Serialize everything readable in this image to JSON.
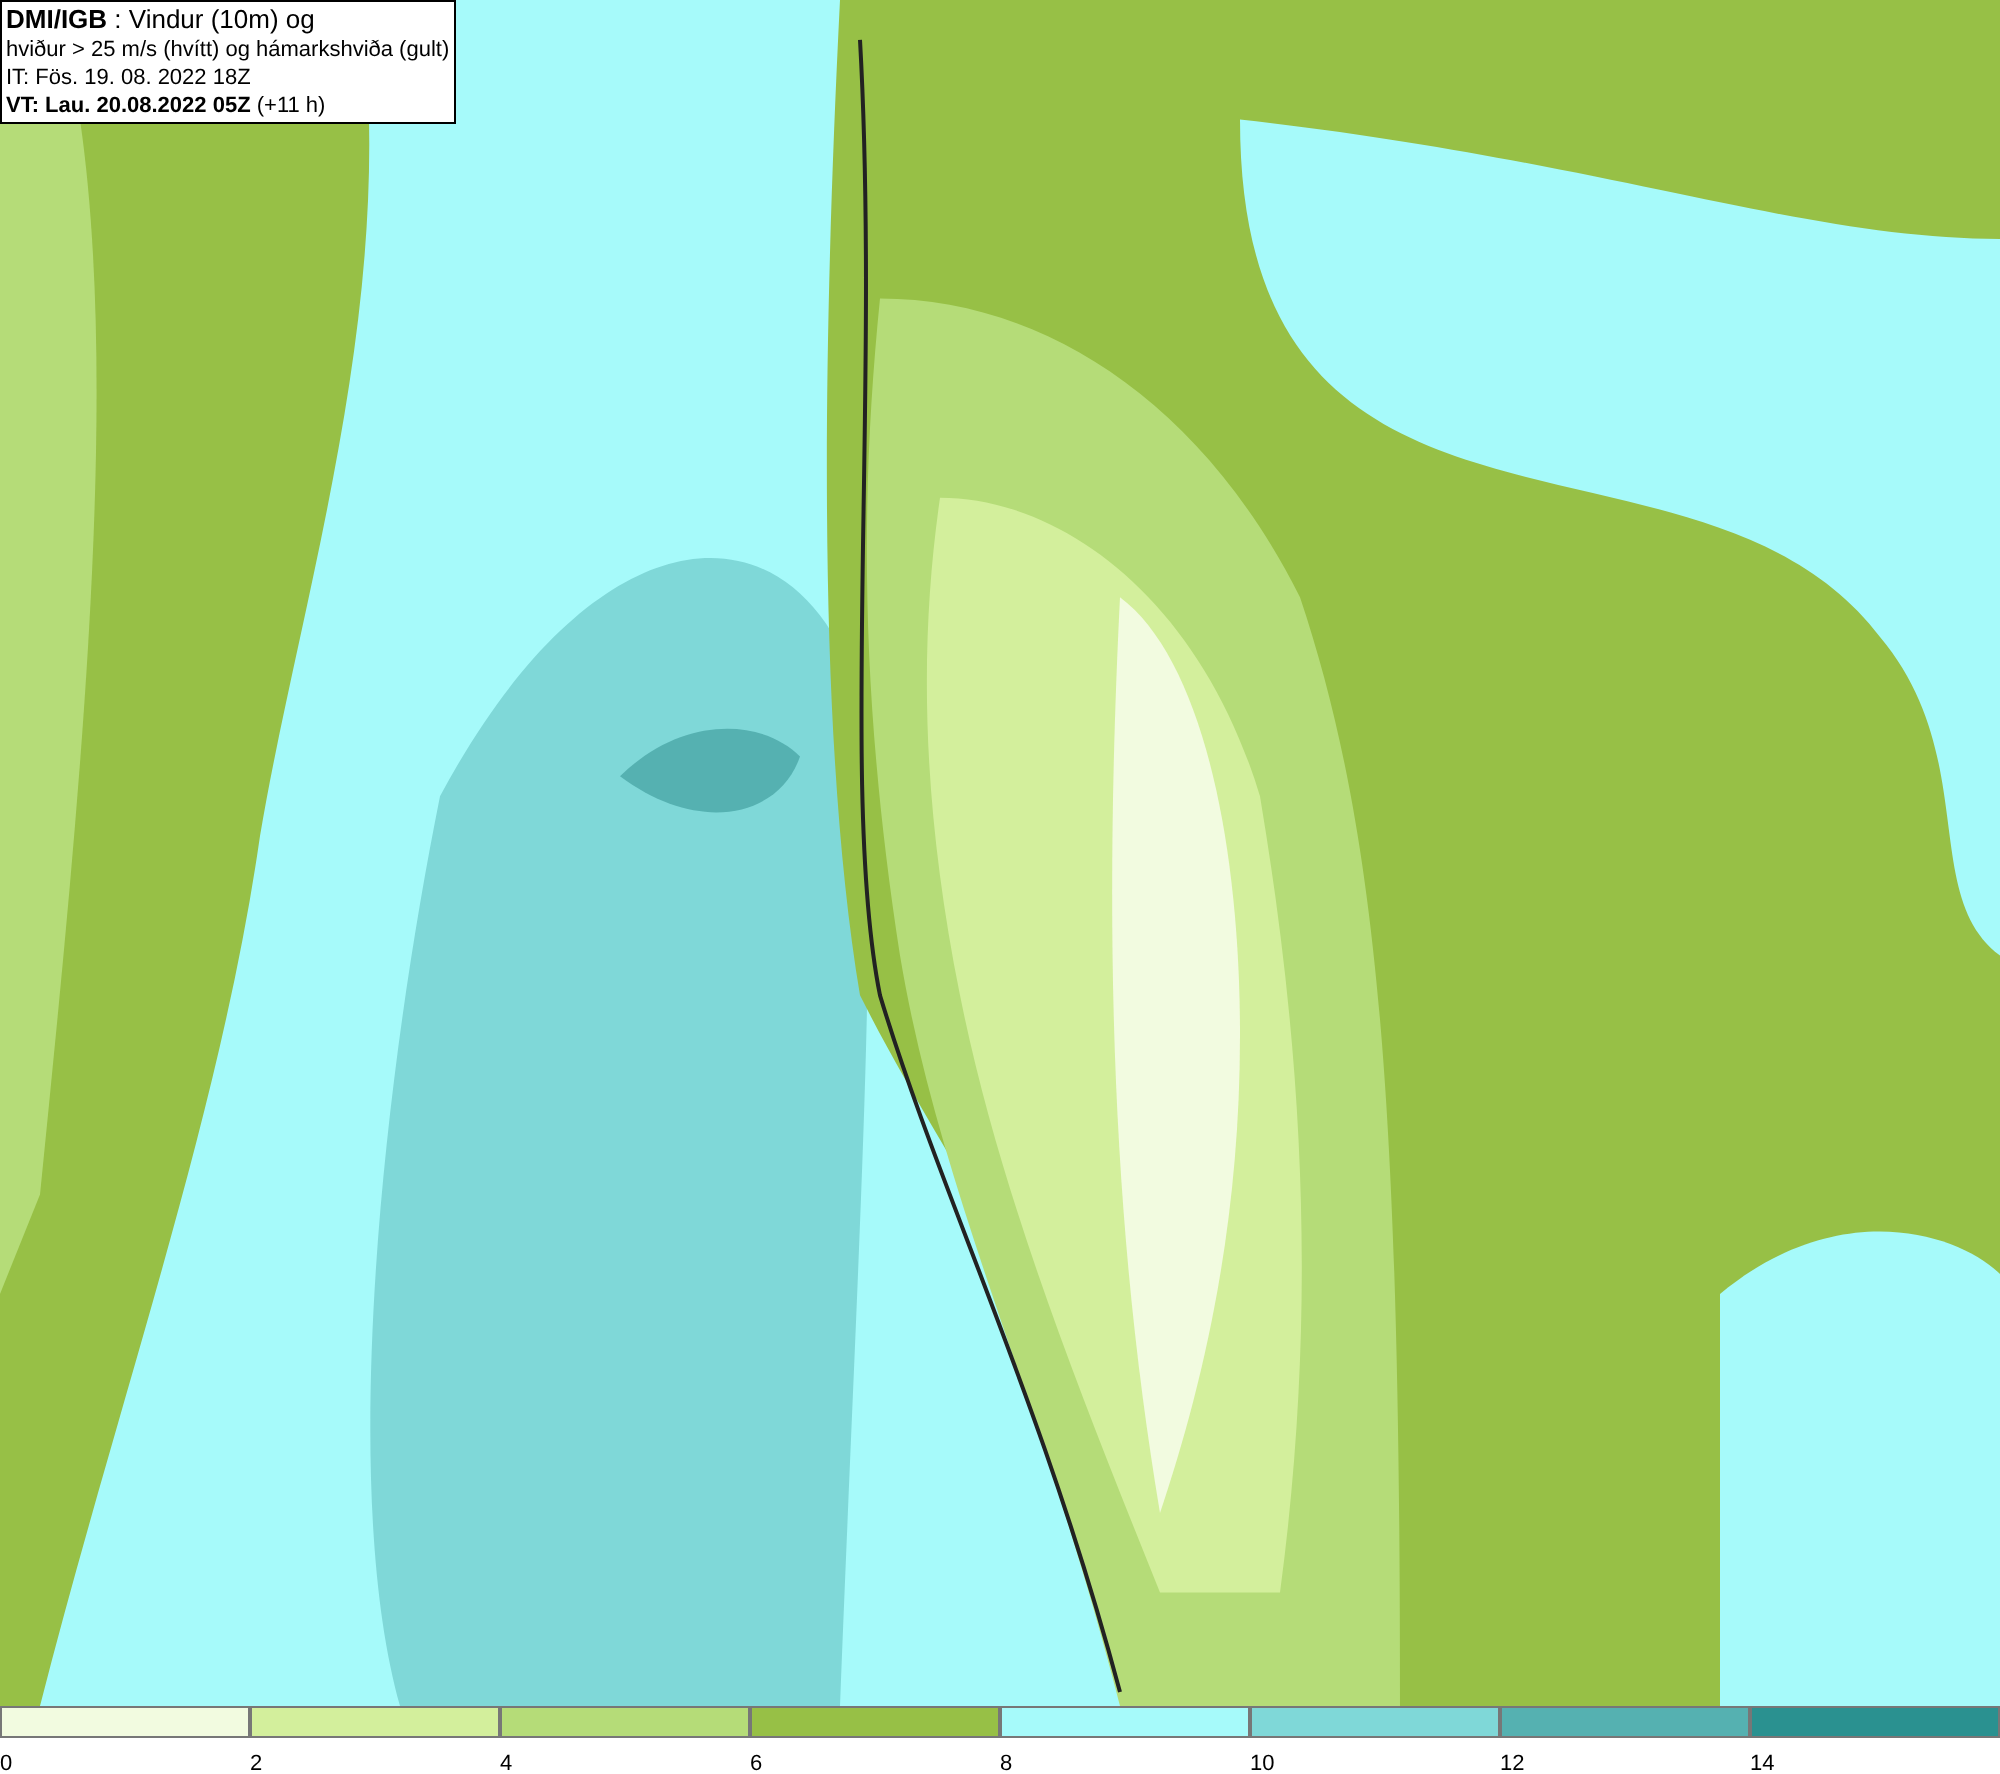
{
  "info_box": {
    "lines": [
      "**DMI/IGB** : Vindur (10m) og",
      "hviður > 25 m/s (hvítt) og hámarkshviða (gult)",
      "IT: Fös. 19. 08. 2022 18Z",
      "**VT: Lau. 20.08.2022 05Z** (+11 h)"
    ]
  },
  "legend": {
    "bins": [
      {
        "label": "0",
        "color": "#f2fbe0"
      },
      {
        "label": "2",
        "color": "#d3ef9c"
      },
      {
        "label": "4",
        "color": "#b5dc78"
      },
      {
        "label": "6",
        "color": "#97c046"
      },
      {
        "label": "8",
        "color": "#a6fafa"
      },
      {
        "label": "10",
        "color": "#7fd8d8"
      },
      {
        "label": "12",
        "color": "#55b1b1"
      },
      {
        "label": "14",
        "color": "#2a9190"
      }
    ]
  }
}
